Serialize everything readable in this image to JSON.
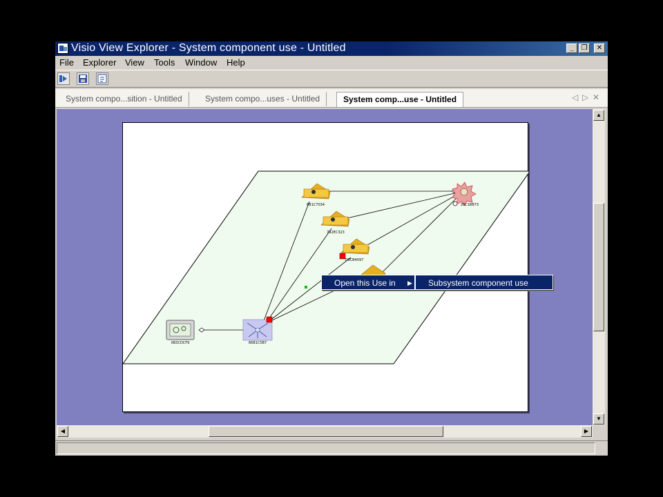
{
  "window": {
    "title": "Visio View Explorer - System component use - Untitled",
    "controls": [
      "_",
      "❐",
      "✕"
    ]
  },
  "menu": [
    "File",
    "Explorer",
    "View",
    "Tools",
    "Window",
    "Help"
  ],
  "toolbar": [
    {
      "icon": "explorer-icon"
    },
    {
      "icon": "save-icon"
    },
    {
      "icon": "refresh-icon"
    }
  ],
  "tabs": [
    {
      "label": "System compo...sition - Untitled"
    },
    {
      "label": "System compo...uses - Untitled"
    },
    {
      "label": "System comp...use - Untitled",
      "active": true
    }
  ],
  "diagram": {
    "nodes": [
      {
        "id": "0B3CDCF9",
        "label": "0B3CDCF9",
        "icon": "hardware-icon"
      },
      {
        "id": "66B1C5B7",
        "label": "66B1C5B7",
        "icon": "network-icon"
      },
      {
        "id": "6B1C7034",
        "label": "6B1C7034",
        "icon": "truck-icon"
      },
      {
        "id": "792EC323",
        "label": "792EC323",
        "icon": "truck-icon"
      },
      {
        "id": "D9CB4097",
        "label": "D9CB4097",
        "icon": "truck-icon"
      },
      {
        "id": "hidden-truck",
        "label": "",
        "icon": "truck-icon"
      },
      {
        "id": "20C1BB73",
        "label": "20C1BB73",
        "icon": "gear-burst-icon"
      }
    ],
    "selection_color": "#ff0000",
    "handle_color": "#00c000"
  },
  "context_menu": {
    "item": "Open this Use in",
    "submenu_item": "Subsystem component use"
  },
  "colors": {
    "titlebar": "#0a246a",
    "workspace": "#8080c0",
    "plane_fill": "#f0fbf0"
  }
}
